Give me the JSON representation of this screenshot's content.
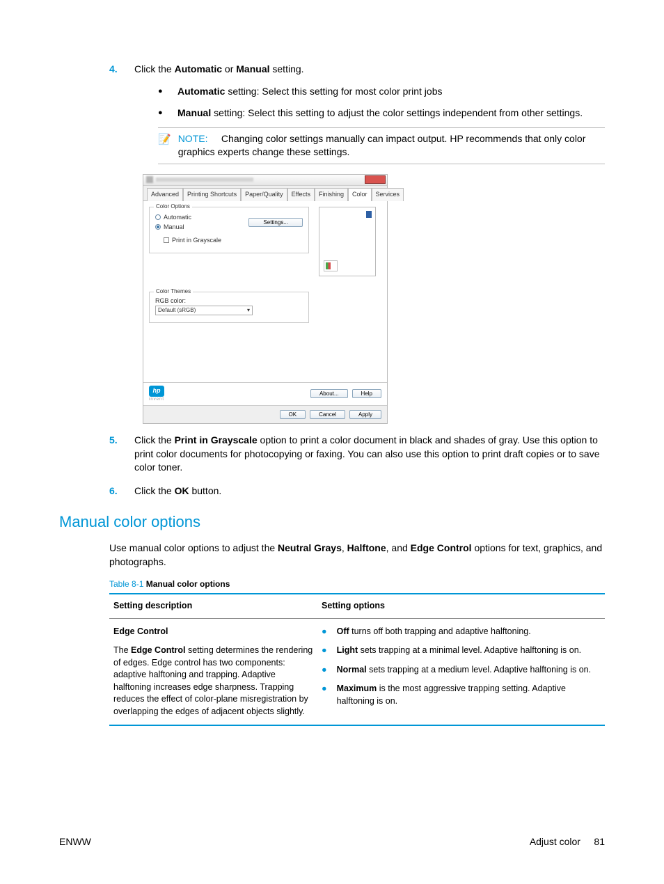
{
  "steps": {
    "s4": {
      "num": "4.",
      "intro_pre": "Click the ",
      "intro_b1": "Automatic",
      "intro_mid": " or ",
      "intro_b2": "Manual",
      "intro_post": " setting.",
      "bullet_auto_b": "Automatic",
      "bullet_auto_t": " setting: Select this setting for most color print jobs",
      "bullet_man_b": "Manual",
      "bullet_man_t": " setting: Select this setting to adjust the color settings independent from other settings.",
      "note_label": "NOTE:",
      "note_text": "Changing color settings manually can impact output. HP recommends that only color graphics experts change these settings."
    },
    "s5": {
      "num": "5.",
      "pre": "Click the ",
      "bold": "Print in Grayscale",
      "post": " option to print a color document in black and shades of gray. Use this option to print color documents for photocopying or faxing. You can also use this option to print draft copies or to save color toner."
    },
    "s6": {
      "num": "6.",
      "pre": "Click the ",
      "bold": "OK",
      "post": " button."
    }
  },
  "dialog": {
    "tabs": [
      "Advanced",
      "Printing Shortcuts",
      "Paper/Quality",
      "Effects",
      "Finishing",
      "Color",
      "Services"
    ],
    "active_tab_index": 5,
    "color_options": {
      "group": "Color Options",
      "automatic": "Automatic",
      "manual": "Manual",
      "settings_btn": "Settings...",
      "grayscale": "Print in Grayscale"
    },
    "color_themes": {
      "group": "Color Themes",
      "rgb_label": "RGB color:",
      "rgb_value": "Default (sRGB)"
    },
    "btns": {
      "about": "About...",
      "help": "Help",
      "ok": "OK",
      "cancel": "Cancel",
      "apply": "Apply"
    }
  },
  "section": {
    "heading": "Manual color options",
    "intro_pre": "Use manual color options to adjust the ",
    "intro_b1": "Neutral Grays",
    "intro_b2": "Halftone",
    "intro_b3": "Edge Control",
    "intro_post": " options for text, graphics, and photographs."
  },
  "table": {
    "caption_label": "Table 8-1",
    "caption_title": "  Manual color options",
    "col1": "Setting description",
    "col2": "Setting options",
    "row1": {
      "title": "Edge Control",
      "desc_pre": "The ",
      "desc_b": "Edge Control",
      "desc_post": " setting determines the rendering of edges. Edge control has two components: adaptive halftoning and trapping. Adaptive halftoning increases edge sharpness. Trapping reduces the effect of color-plane misregistration by overlapping the edges of adjacent objects slightly.",
      "opts": [
        {
          "b": "Off",
          "t": " turns off both trapping and adaptive halftoning."
        },
        {
          "b": "Light",
          "t": " sets trapping at a minimal level. Adaptive halftoning is on."
        },
        {
          "b": "Normal",
          "t": " sets trapping at a medium level. Adaptive halftoning is on."
        },
        {
          "b": "Maximum",
          "t": " is the most aggressive trapping setting. Adaptive halftoning is on."
        }
      ]
    }
  },
  "footer": {
    "left": "ENWW",
    "right_label": "Adjust color",
    "right_num": "81"
  }
}
